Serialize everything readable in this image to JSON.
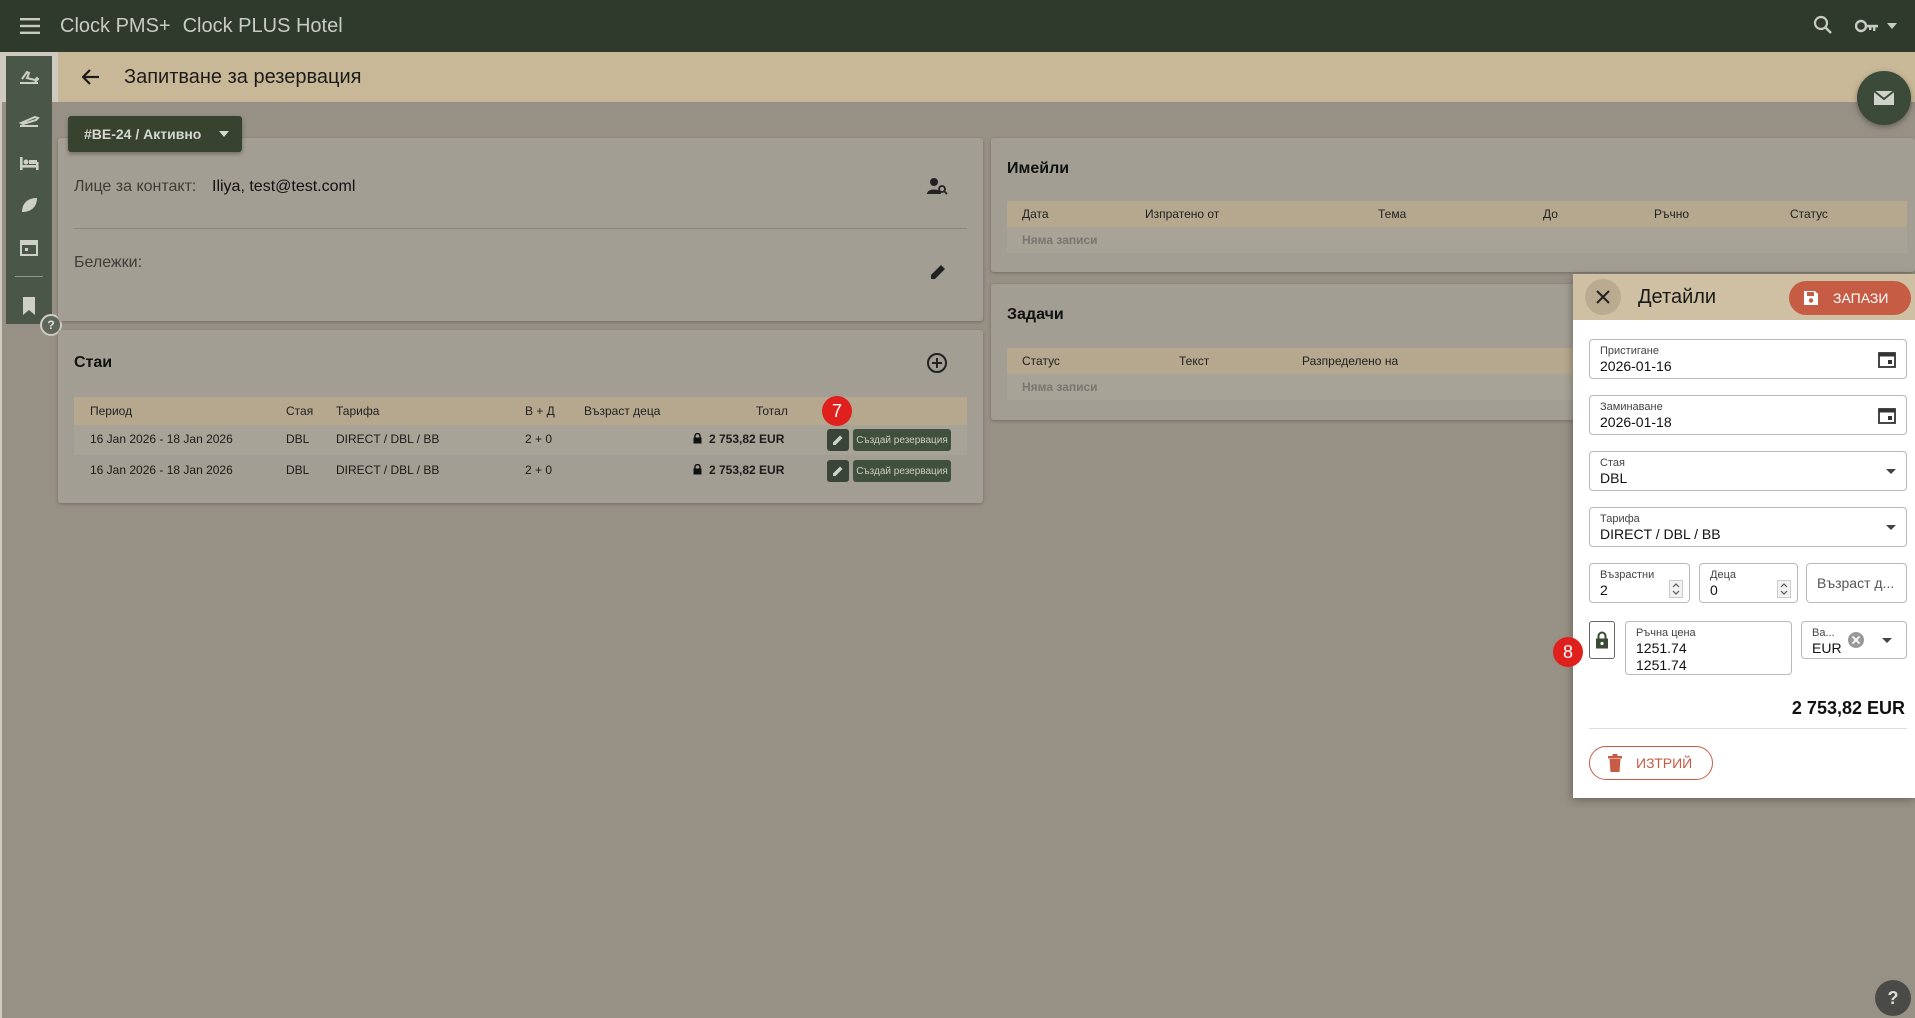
{
  "topbar": {
    "app_name": "Clock PMS+",
    "hotel_name": "Clock PLUS Hotel"
  },
  "page": {
    "title": "Запитване за резервация"
  },
  "status": {
    "label": "#BE-24 / Активно"
  },
  "contact": {
    "label": "Лице за контакт:",
    "value": "Iliya, test@test.coml",
    "notes_label": "Бележки:"
  },
  "rooms": {
    "title": "Стаи",
    "columns": [
      "Период",
      "Стая",
      "Тарифа",
      "В + Д",
      "Възраст деца",
      "Тотал"
    ],
    "rows": [
      {
        "period": "16 Jan 2026 - 18 Jan 2026",
        "room": "DBL",
        "rate": "DIRECT / DBL / BB",
        "guests": "2 + 0",
        "ages": "",
        "total": "2 753,82 EUR",
        "action": "Създай резервация"
      },
      {
        "period": "16 Jan 2026 - 18 Jan 2026",
        "room": "DBL",
        "rate": "DIRECT / DBL / BB",
        "guests": "2 + 0",
        "ages": "",
        "total": "2 753,82 EUR",
        "action": "Създай резервация"
      }
    ]
  },
  "emails": {
    "title": "Имейли",
    "columns": [
      "Дата",
      "Изпратено от",
      "Тема",
      "До",
      "Ръчно",
      "Статус"
    ],
    "empty": "Няма записи"
  },
  "tasks": {
    "title": "Задачи",
    "columns": [
      "Статус",
      "Текст",
      "Разпределено на"
    ],
    "empty": "Няма записи"
  },
  "details": {
    "title": "Детайли",
    "save": "ЗАПАЗИ",
    "arrival": {
      "label": "Пристигане",
      "value": "2026-01-16"
    },
    "departure": {
      "label": "Заминаване",
      "value": "2026-01-18"
    },
    "room": {
      "label": "Стая",
      "value": "DBL"
    },
    "rate": {
      "label": "Тарифа",
      "value": "DIRECT / DBL / BB"
    },
    "adults": {
      "label": "Възрастни",
      "value": "2"
    },
    "children": {
      "label": "Деца",
      "value": "0"
    },
    "child_ages": {
      "placeholder": "Възраст д..."
    },
    "manual_price": {
      "label": "Ръчна цена",
      "value": "1251.74",
      "value2": "1251.74"
    },
    "currency": {
      "label": "Ва...",
      "value": "EUR"
    },
    "total": "2 753,82 EUR",
    "delete": "ИЗТРИЙ"
  },
  "badges": {
    "seven": "7",
    "eight": "8"
  },
  "help": "?",
  "colors": {
    "topbar": "#2f3a2d",
    "accent": "#c65c44",
    "badge": "#e0201c"
  }
}
